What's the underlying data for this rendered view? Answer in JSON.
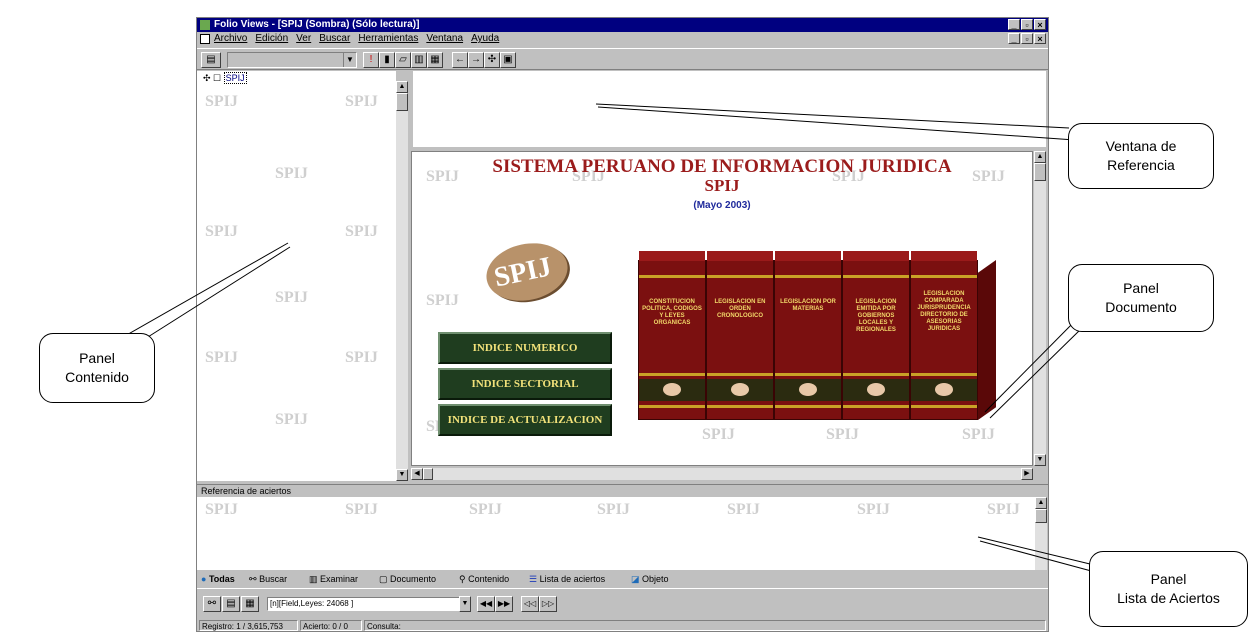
{
  "window": {
    "title": "Folio Views - [SPIJ (Sombra)   (Sólo lectura)]",
    "controls": [
      "_",
      "▫",
      "×"
    ]
  },
  "menubar": {
    "items": [
      "Archivo",
      "Edición",
      "Ver",
      "Buscar",
      "Herramientas",
      "Ventana",
      "Ayuda"
    ]
  },
  "toolbar": {
    "combo_value": "",
    "icons": [
      "print-icon",
      "bookmark-icon",
      "highlight-icon",
      "note-icon",
      "popup-icon",
      "link-icon",
      "back-icon",
      "forward-icon",
      "tools-icon",
      "window-icon"
    ]
  },
  "contents_panel": {
    "tree_root": "SPIJ",
    "watermark": "SPIJ"
  },
  "document_panel": {
    "title": "SISTEMA PERUANO DE INFORMACION JURIDICA",
    "subtitle": "SPIJ",
    "date": "(Mayo 2003)",
    "logo": "SPIJ",
    "buttons": [
      "INDICE NUMERICO",
      "INDICE SECTORIAL",
      "INDICE DE ACTUALIZACION"
    ],
    "books": [
      "CONSTITUCION POLITICA, CODIGOS Y LEYES ORGANICAS",
      "LEGISLACION EN ORDEN CRONOLOGICO",
      "LEGISLACION POR MATERIAS",
      "LEGISLACION EMITIDA POR GOBIERNOS LOCALES Y REGIONALES",
      "LEGISLACION COMPARADA  JURISPRUDENCIA  DIRECTORIO DE ASESORIAS JURIDICAS"
    ]
  },
  "hits_panel": {
    "header": "Referencia de aciertos"
  },
  "tabs": [
    "Todas",
    "Buscar",
    "Examinar",
    "Documento",
    "Contenido",
    "Lista de aciertos",
    "Objeto"
  ],
  "search_bar": {
    "query": "[n][Field,Leyes: 24068 ]"
  },
  "status": {
    "registro": "Registro: 1 / 3,615,753",
    "acierto": "Acierto: 0 / 0",
    "consulta": "Consulta:"
  },
  "callouts": {
    "reference": [
      "Ventana de",
      "Referencia"
    ],
    "document": [
      "Panel",
      "Documento"
    ],
    "contents": [
      "Panel",
      "Contenido"
    ],
    "hits": [
      "Panel",
      "Lista de Aciertos"
    ]
  }
}
